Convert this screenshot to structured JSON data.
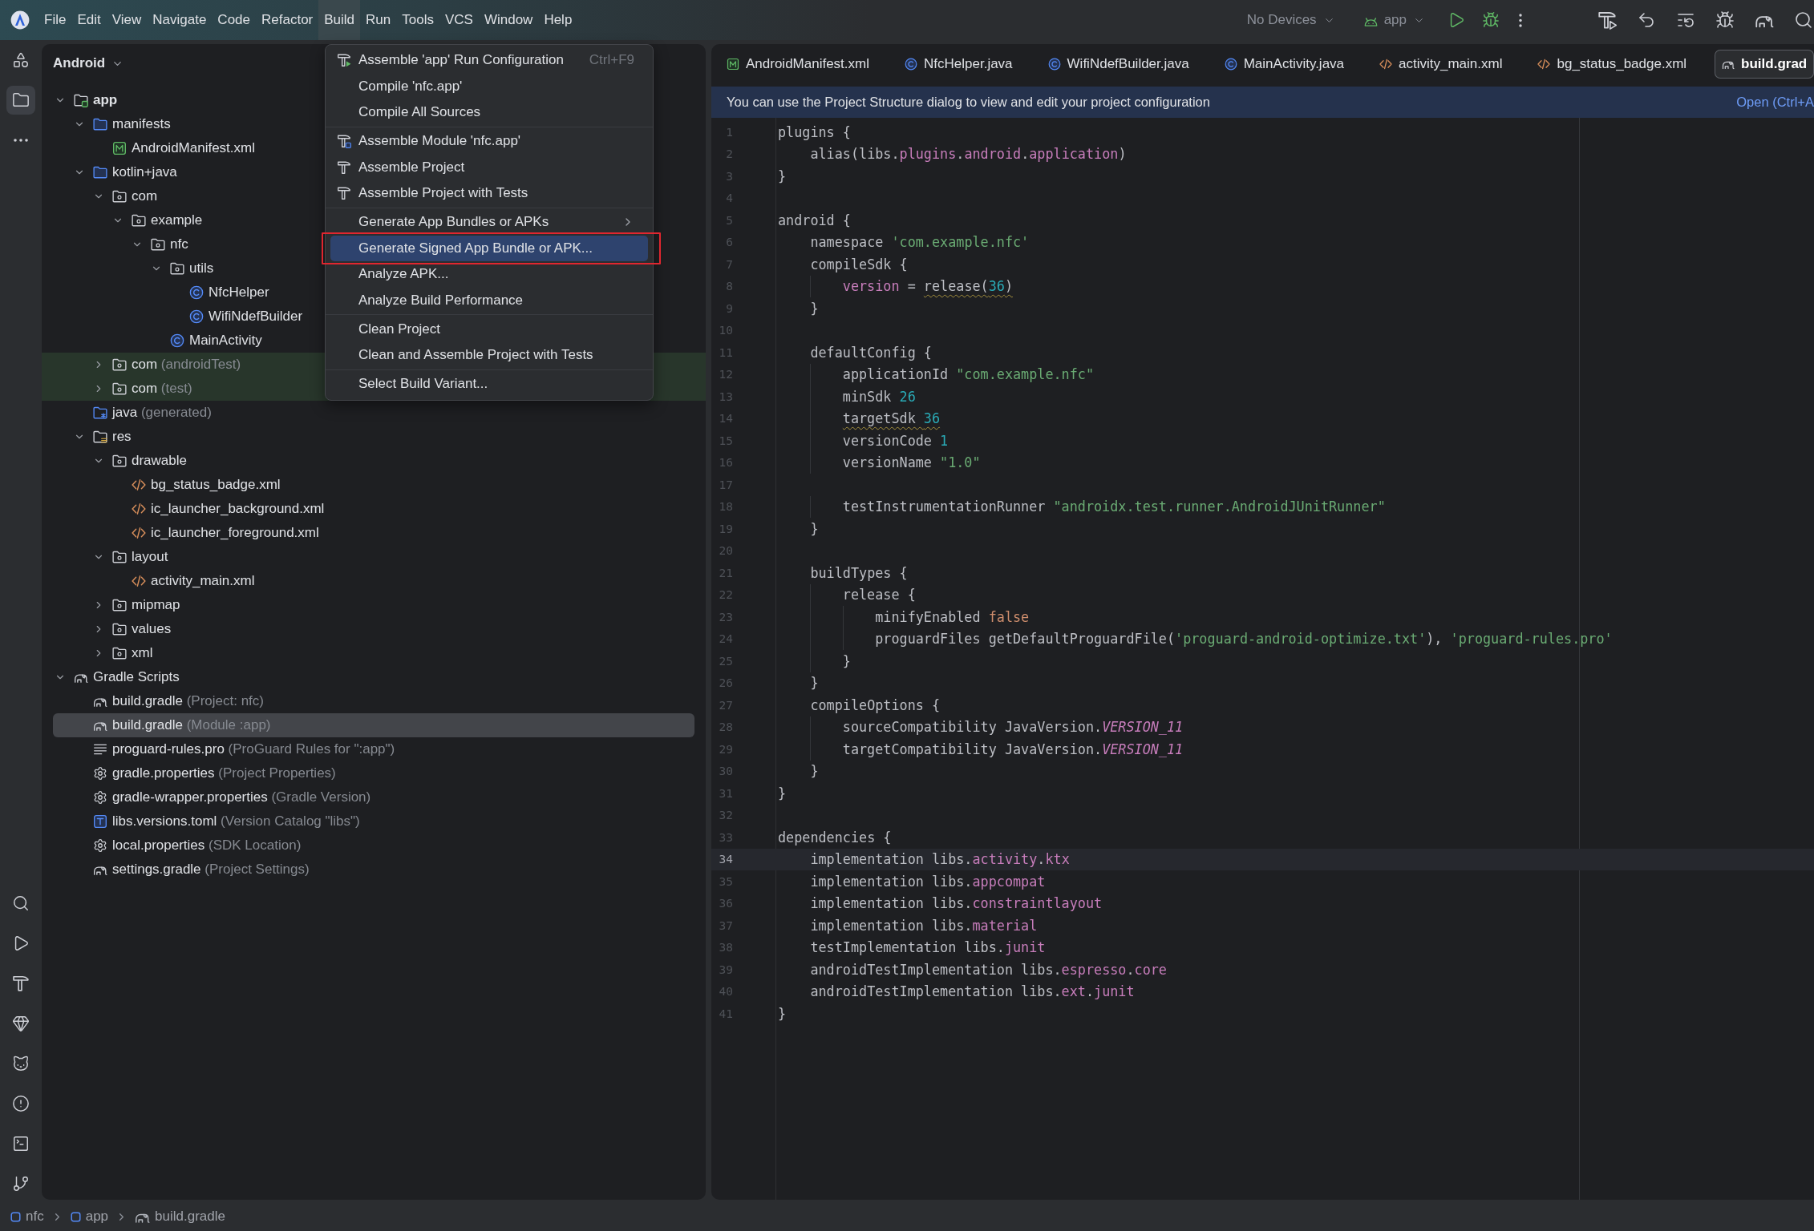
{
  "title_bar": {
    "menu": [
      {
        "label": "File",
        "selected": false
      },
      {
        "label": "Edit",
        "selected": false
      },
      {
        "label": "View",
        "selected": false
      },
      {
        "label": "Navigate",
        "selected": false
      },
      {
        "label": "Code",
        "selected": false
      },
      {
        "label": "Refactor",
        "selected": false
      },
      {
        "label": "Build",
        "selected": true
      },
      {
        "label": "Run",
        "selected": false
      },
      {
        "label": "Tools",
        "selected": false
      },
      {
        "label": "VCS",
        "selected": false
      },
      {
        "label": "Window",
        "selected": false
      },
      {
        "label": "Help",
        "selected": false
      }
    ],
    "device_selector": "No Devices",
    "run_configuration": "app"
  },
  "tool_strip": [
    {
      "kind": "resources",
      "selected": false
    },
    {
      "kind": "project",
      "selected": true
    },
    {
      "kind": "more",
      "selected": false
    }
  ],
  "project": {
    "view": "Android",
    "tree": [
      {
        "label": "app",
        "kind": "module",
        "expanded": true,
        "selected": false,
        "children": [
          {
            "label": "manifests",
            "kind": "sources",
            "expanded": true,
            "selected": false,
            "children": [
              {
                "label": "AndroidManifest.xml",
                "kind": "manifest",
                "selected": false
              }
            ]
          },
          {
            "label": "kotlin+java",
            "kind": "sources",
            "expanded": true,
            "selected": false,
            "children": [
              {
                "label": "com",
                "kind": "package",
                "expanded": true,
                "selected": false,
                "children": [
                  {
                    "label": "example",
                    "kind": "package",
                    "expanded": true,
                    "selected": false,
                    "children": [
                      {
                        "label": "nfc",
                        "kind": "package",
                        "expanded": true,
                        "selected": false,
                        "children": [
                          {
                            "label": "utils",
                            "kind": "package",
                            "expanded": true,
                            "selected": false,
                            "children": [
                              {
                                "label": "NfcHelper",
                                "kind": "class",
                                "selected": false
                              },
                              {
                                "label": "WifiNdefBuilder",
                                "kind": "class",
                                "selected": false
                              }
                            ]
                          },
                          {
                            "label": "MainActivity",
                            "kind": "class",
                            "selected": false
                          }
                        ]
                      }
                    ]
                  }
                ]
              },
              {
                "label": "com",
                "note": "(androidTest)",
                "kind": "package",
                "expanded": false,
                "selected": false,
                "color": "#28362b"
              },
              {
                "label": "com",
                "note": "(test)",
                "kind": "package",
                "expanded": false,
                "selected": false,
                "color": "#28362b"
              }
            ]
          },
          {
            "label": "java",
            "note": "(generated)",
            "kind": "generated",
            "selected": false
          },
          {
            "label": "res",
            "kind": "resources",
            "expanded": true,
            "selected": false,
            "children": [
              {
                "label": "drawable",
                "kind": "package",
                "expanded": true,
                "selected": false,
                "children": [
                  {
                    "label": "bg_status_badge.xml",
                    "kind": "xml",
                    "selected": false
                  },
                  {
                    "label": "ic_launcher_background.xml",
                    "kind": "xml",
                    "selected": false
                  },
                  {
                    "label": "ic_launcher_foreground.xml",
                    "kind": "xml",
                    "selected": false
                  }
                ]
              },
              {
                "label": "layout",
                "kind": "package",
                "expanded": true,
                "selected": false,
                "children": [
                  {
                    "label": "activity_main.xml",
                    "kind": "xml",
                    "selected": false
                  }
                ]
              },
              {
                "label": "mipmap",
                "kind": "package",
                "expanded": false,
                "selected": false
              },
              {
                "label": "values",
                "kind": "package",
                "expanded": false,
                "selected": false
              },
              {
                "label": "xml",
                "kind": "package",
                "expanded": false,
                "selected": false
              }
            ]
          }
        ]
      },
      {
        "label": "Gradle Scripts",
        "kind": "gradle",
        "expanded": true,
        "selected": false,
        "children": [
          {
            "label": "build.gradle",
            "note": "(Project: nfc)",
            "kind": "gradle",
            "selected": false
          },
          {
            "label": "build.gradle",
            "note": "(Module :app)",
            "kind": "gradle",
            "selected": true
          },
          {
            "label": "proguard-rules.pro",
            "note": "(ProGuard Rules for \":app\")",
            "kind": "text",
            "selected": false
          },
          {
            "label": "gradle.properties",
            "note": "(Project Properties)",
            "kind": "properties",
            "selected": false
          },
          {
            "label": "gradle-wrapper.properties",
            "note": "(Gradle Version)",
            "kind": "properties",
            "selected": false
          },
          {
            "label": "libs.versions.toml",
            "note": "(Version Catalog \"libs\")",
            "kind": "catalog",
            "selected": false
          },
          {
            "label": "local.properties",
            "note": "(SDK Location)",
            "kind": "properties",
            "selected": false
          },
          {
            "label": "settings.gradle",
            "note": "(Project Settings)",
            "kind": "gradle",
            "selected": false
          }
        ]
      }
    ]
  },
  "build_menu": {
    "groups": [
      {
        "items": [
          {
            "label": "Assemble 'app' Run Configuration",
            "kind": "run",
            "shortcut": "Ctrl+F9",
            "selected": false,
            "outlined": false
          },
          {
            "label": "Compile 'nfc.app'",
            "kind": "plain",
            "selected": false,
            "outlined": false
          },
          {
            "label": "Compile All Sources",
            "kind": "plain",
            "selected": false,
            "outlined": false
          }
        ]
      },
      {
        "items": [
          {
            "label": "Assemble Module 'nfc.app'",
            "kind": "module",
            "selected": false,
            "outlined": false
          },
          {
            "label": "Assemble Project",
            "kind": "build",
            "selected": false,
            "outlined": false
          },
          {
            "label": "Assemble Project with Tests",
            "kind": "build",
            "selected": false,
            "outlined": false
          }
        ]
      },
      {
        "items": [
          {
            "label": "Generate App Bundles or APKs",
            "kind": "submenu",
            "selected": false,
            "outlined": false
          },
          {
            "label": "Generate Signed App Bundle or APK...",
            "kind": "plain",
            "selected": true,
            "outlined": true
          },
          {
            "label": "Analyze APK...",
            "kind": "plain",
            "selected": false,
            "outlined": false
          },
          {
            "label": "Analyze Build Performance",
            "kind": "plain",
            "selected": false,
            "outlined": false
          }
        ]
      },
      {
        "items": [
          {
            "label": "Clean Project",
            "kind": "plain",
            "selected": false,
            "outlined": false
          },
          {
            "label": "Clean and Assemble Project with Tests",
            "kind": "plain",
            "selected": false,
            "outlined": false
          }
        ]
      },
      {
        "items": [
          {
            "label": "Select Build Variant...",
            "kind": "plain",
            "selected": false,
            "outlined": false
          }
        ]
      }
    ]
  },
  "editor": {
    "tabs": [
      {
        "label": "AndroidManifest.xml",
        "kind": "manifest",
        "selected": false
      },
      {
        "label": "NfcHelper.java",
        "kind": "class",
        "selected": false
      },
      {
        "label": "WifiNdefBuilder.java",
        "kind": "class",
        "selected": false
      },
      {
        "label": "MainActivity.java",
        "kind": "class",
        "selected": false
      },
      {
        "label": "activity_main.xml",
        "kind": "xml",
        "selected": false
      },
      {
        "label": "bg_status_badge.xml",
        "kind": "xml",
        "selected": false
      },
      {
        "label": "build.grad",
        "kind": "gradle",
        "selected": true
      }
    ],
    "banner": {
      "text": "You can use the Project Structure dialog to view and edit your project configuration",
      "link": "Open (Ctrl+A"
    },
    "lines": [
      {
        "number": "1",
        "current": false,
        "tokens": [
          {
            "text": "plugins {",
            "kind": "plain"
          }
        ]
      },
      {
        "number": "2",
        "current": false,
        "tokens": [
          {
            "text": "    alias(libs.",
            "kind": "plain"
          },
          {
            "text": "plugins.android.application",
            "kind": "member"
          },
          {
            "text": ")",
            "kind": "plain"
          }
        ]
      },
      {
        "number": "3",
        "current": false,
        "tokens": [
          {
            "text": "}",
            "kind": "plain"
          }
        ]
      },
      {
        "number": "4",
        "current": false
      },
      {
        "number": "5",
        "current": false,
        "tokens": [
          {
            "text": "android {",
            "kind": "plain"
          }
        ]
      },
      {
        "number": "6",
        "current": false,
        "tokens": [
          {
            "text": "    namespace ",
            "kind": "plain"
          },
          {
            "text": "'com.example.nfc'",
            "kind": "string"
          }
        ]
      },
      {
        "number": "7",
        "current": false,
        "tokens": [
          {
            "text": "    compileSdk {",
            "kind": "plain"
          }
        ]
      },
      {
        "number": "8",
        "current": false,
        "tokens": [
          {
            "text": "        version",
            "kind": "member"
          },
          {
            "text": " = ",
            "kind": "plain"
          },
          {
            "text": "release(",
            "kind": "warning"
          },
          {
            "text": "36",
            "kind": "warningnum"
          },
          {
            "text": ")",
            "kind": "warning"
          }
        ]
      },
      {
        "number": "9",
        "current": false,
        "tokens": [
          {
            "text": "    }",
            "kind": "plain"
          }
        ]
      },
      {
        "number": "10",
        "current": false
      },
      {
        "number": "11",
        "current": false,
        "tokens": [
          {
            "text": "    defaultConfig {",
            "kind": "plain"
          }
        ]
      },
      {
        "number": "12",
        "current": false,
        "tokens": [
          {
            "text": "        applicationId ",
            "kind": "plain"
          },
          {
            "text": "\"com.example.nfc\"",
            "kind": "string"
          }
        ]
      },
      {
        "number": "13",
        "current": false,
        "tokens": [
          {
            "text": "        minSdk ",
            "kind": "plain"
          },
          {
            "text": "26",
            "kind": "number"
          }
        ]
      },
      {
        "number": "14",
        "current": false,
        "tokens": [
          {
            "text": "        targetSdk ",
            "kind": "warning"
          },
          {
            "text": "36",
            "kind": "warningnum"
          }
        ]
      },
      {
        "number": "15",
        "current": false,
        "tokens": [
          {
            "text": "        versionCode ",
            "kind": "plain"
          },
          {
            "text": "1",
            "kind": "number"
          }
        ]
      },
      {
        "number": "16",
        "current": false,
        "tokens": [
          {
            "text": "        versionName ",
            "kind": "plain"
          },
          {
            "text": "\"1.0\"",
            "kind": "string"
          }
        ]
      },
      {
        "number": "17",
        "current": false
      },
      {
        "number": "18",
        "current": false,
        "tokens": [
          {
            "text": "        testInstrumentationRunner ",
            "kind": "plain"
          },
          {
            "text": "\"androidx.test.runner.AndroidJUnitRunner\"",
            "kind": "string"
          }
        ]
      },
      {
        "number": "19",
        "current": false,
        "tokens": [
          {
            "text": "    }",
            "kind": "plain"
          }
        ]
      },
      {
        "number": "20",
        "current": false
      },
      {
        "number": "21",
        "current": false,
        "tokens": [
          {
            "text": "    buildTypes {",
            "kind": "plain"
          }
        ]
      },
      {
        "number": "22",
        "current": false,
        "tokens": [
          {
            "text": "        release {",
            "kind": "plain"
          }
        ]
      },
      {
        "number": "23",
        "current": false,
        "tokens": [
          {
            "text": "            minifyEnabled ",
            "kind": "plain"
          },
          {
            "text": "false",
            "kind": "keyword"
          }
        ]
      },
      {
        "number": "24",
        "current": false,
        "tokens": [
          {
            "text": "            proguardFiles getDefaultProguardFile(",
            "kind": "plain"
          },
          {
            "text": "'proguard-android-optimize.txt'",
            "kind": "string"
          },
          {
            "text": "), ",
            "kind": "plain"
          },
          {
            "text": "'proguard-rules.pro'",
            "kind": "string"
          }
        ]
      },
      {
        "number": "25",
        "current": false,
        "tokens": [
          {
            "text": "        }",
            "kind": "plain"
          }
        ]
      },
      {
        "number": "26",
        "current": false,
        "tokens": [
          {
            "text": "    }",
            "kind": "plain"
          }
        ]
      },
      {
        "number": "27",
        "current": false,
        "tokens": [
          {
            "text": "    compileOptions {",
            "kind": "plain"
          }
        ]
      },
      {
        "number": "28",
        "current": false,
        "tokens": [
          {
            "text": "        sourceCompatibility JavaVersion.",
            "kind": "plain"
          },
          {
            "text": "VERSION_11",
            "kind": "constant"
          }
        ]
      },
      {
        "number": "29",
        "current": false,
        "tokens": [
          {
            "text": "        targetCompatibility JavaVersion.",
            "kind": "plain"
          },
          {
            "text": "VERSION_11",
            "kind": "constant"
          }
        ]
      },
      {
        "number": "30",
        "current": false,
        "tokens": [
          {
            "text": "    }",
            "kind": "plain"
          }
        ]
      },
      {
        "number": "31",
        "current": false,
        "tokens": [
          {
            "text": "}",
            "kind": "plain"
          }
        ]
      },
      {
        "number": "32",
        "current": false
      },
      {
        "number": "33",
        "current": false,
        "tokens": [
          {
            "text": "dependencies {",
            "kind": "plain"
          }
        ]
      },
      {
        "number": "34",
        "current": true,
        "tokens": [
          {
            "text": "    implementation libs.",
            "kind": "plain"
          },
          {
            "text": "activity.ktx",
            "kind": "member"
          }
        ]
      },
      {
        "number": "35",
        "current": false,
        "tokens": [
          {
            "text": "    implementation libs.",
            "kind": "plain"
          },
          {
            "text": "appcompat",
            "kind": "member"
          }
        ]
      },
      {
        "number": "36",
        "current": false,
        "tokens": [
          {
            "text": "    implementation libs.",
            "kind": "plain"
          },
          {
            "text": "constraintlayout",
            "kind": "member"
          }
        ]
      },
      {
        "number": "37",
        "current": false,
        "tokens": [
          {
            "text": "    implementation libs.",
            "kind": "plain"
          },
          {
            "text": "material",
            "kind": "member"
          }
        ]
      },
      {
        "number": "38",
        "current": false,
        "tokens": [
          {
            "text": "    testImplementation libs.",
            "kind": "plain"
          },
          {
            "text": "junit",
            "kind": "member"
          }
        ]
      },
      {
        "number": "39",
        "current": false,
        "tokens": [
          {
            "text": "    androidTestImplementation libs.",
            "kind": "plain"
          },
          {
            "text": "espresso.core",
            "kind": "member"
          }
        ]
      },
      {
        "number": "40",
        "current": false,
        "tokens": [
          {
            "text": "    androidTestImplementation libs.",
            "kind": "plain"
          },
          {
            "text": "ext.junit",
            "kind": "member"
          }
        ]
      },
      {
        "number": "41",
        "current": false,
        "tokens": [
          {
            "text": "}",
            "kind": "plain"
          }
        ]
      }
    ]
  },
  "breadcrumbs": [
    {
      "label": "nfc",
      "kind": "module"
    },
    {
      "label": "app",
      "kind": "module"
    },
    {
      "label": "build.gradle",
      "kind": "gradle"
    }
  ]
}
